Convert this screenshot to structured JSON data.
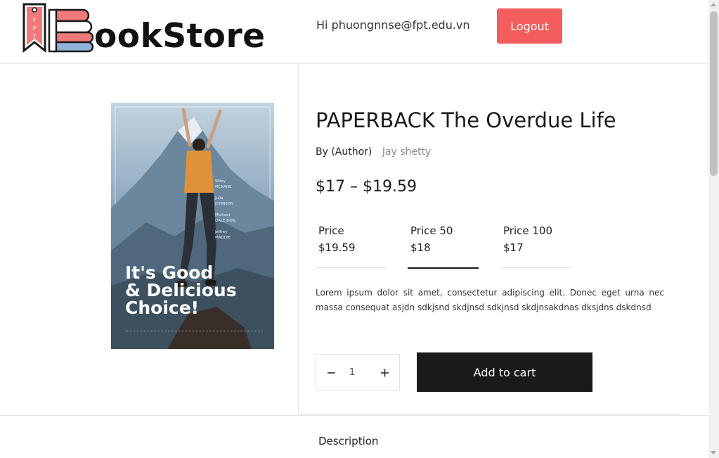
{
  "header": {
    "logo_text": "ookStore",
    "logo_tag_letters": [
      "F",
      "P",
      "T"
    ],
    "greeting": "Hi phuongnnse@fpt.edu.vn",
    "logout_label": "Logout"
  },
  "product": {
    "cover": {
      "title": "It's Good\n& Delicious\nChoice!",
      "names": "Wiley\nMCKANE\n\nJulia\nJOHNSON\n\nMichael\nDALE DON\n\nJeffrey\nMADDIE"
    },
    "title": "PAPERBACK The Overdue Life",
    "by_label": "By (Author)",
    "author": "Jay shetty",
    "price_range": "$17 – $19.59",
    "price_options": [
      {
        "label": "Price",
        "value": "$19.59",
        "selected": false
      },
      {
        "label": "Price 50",
        "value": "$18",
        "selected": true
      },
      {
        "label": "Price 100",
        "value": "$17",
        "selected": false
      }
    ],
    "description": "Lorem ipsum dolor sit amet, consectetur adipiscing elit. Donec eget urna nec massa consequat asjdn sdkjsnd skdjnsd sdkjnsd skdjnsakdnas dksjdns dskdnsd",
    "quantity": "1",
    "add_to_cart_label": "Add to cart"
  },
  "tabs": {
    "description_label": "Description"
  },
  "colors": {
    "accent": "#f35d5d",
    "dark_button": "#1a1a1a",
    "logo_blue": "#8fb3d9",
    "logo_red": "#f07a7a"
  }
}
